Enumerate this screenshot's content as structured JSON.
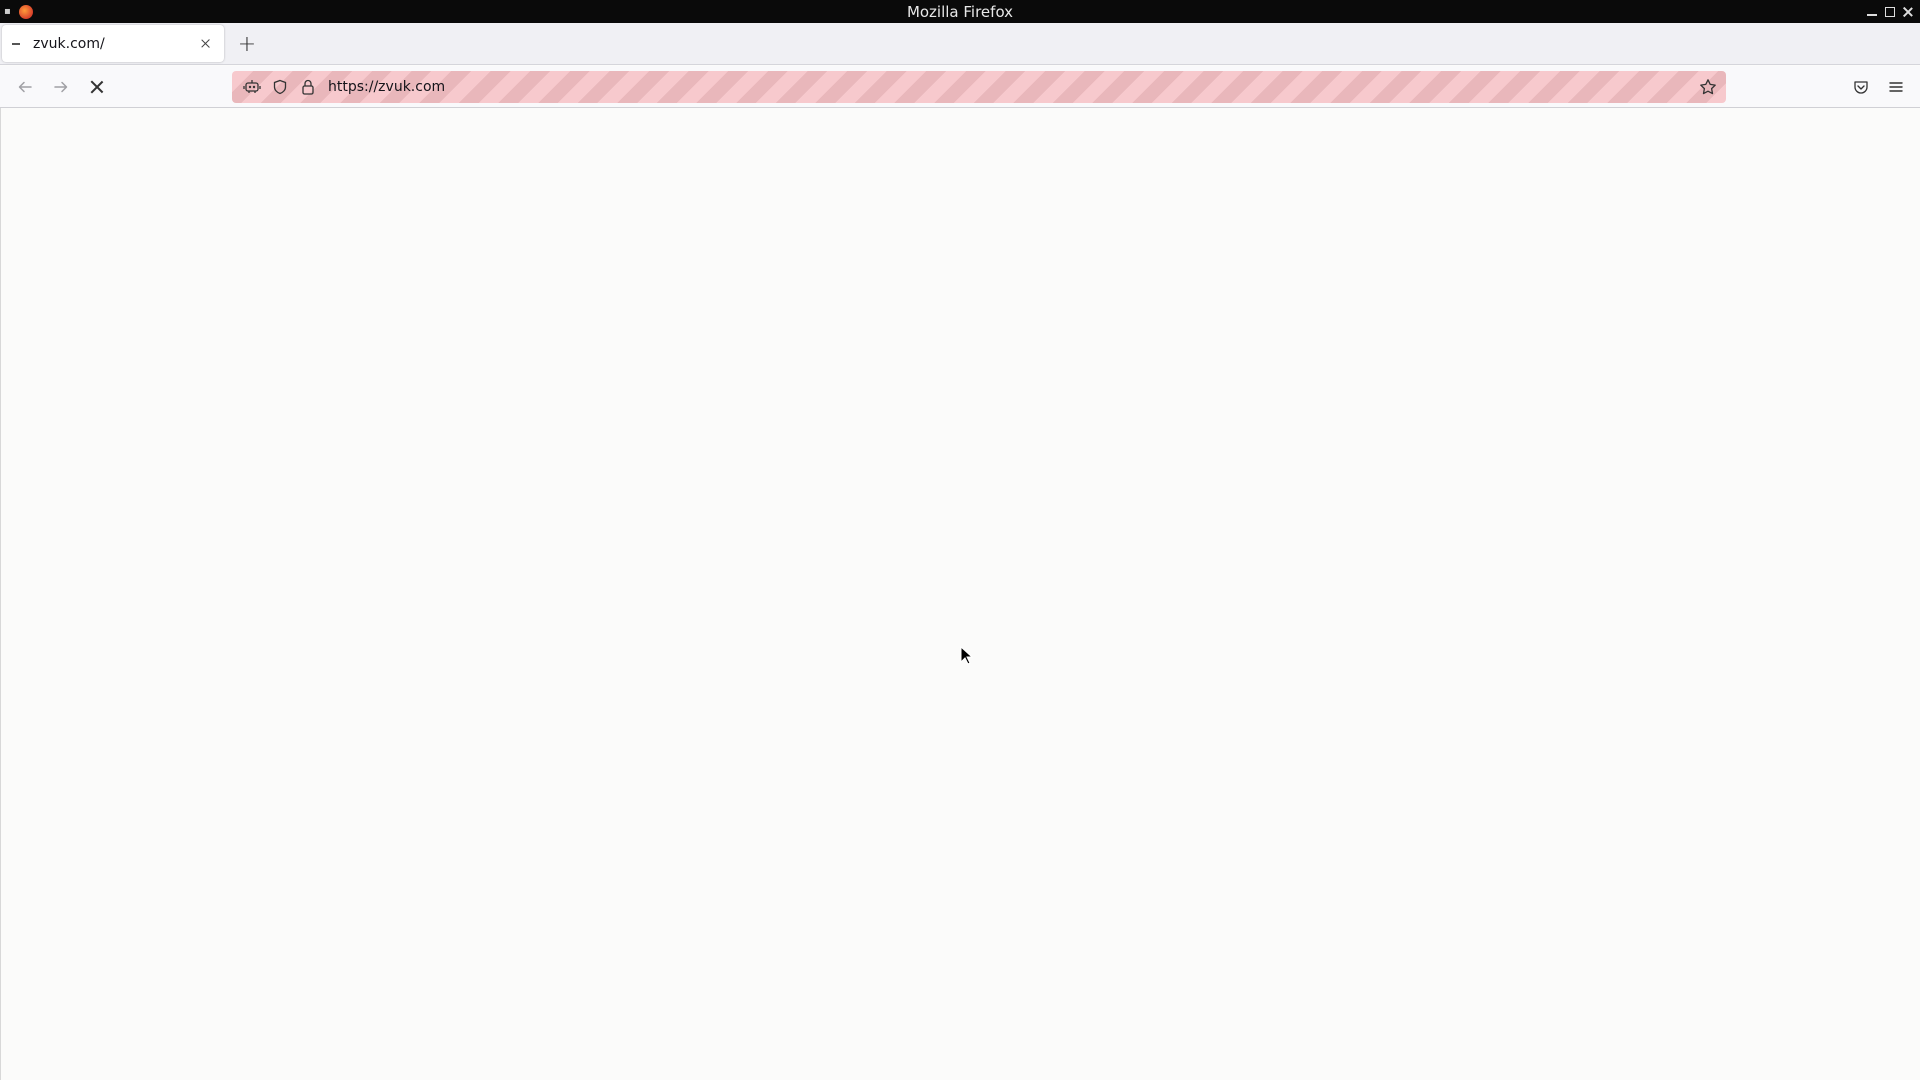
{
  "window": {
    "title": "Mozilla Firefox"
  },
  "tabs": [
    {
      "label": "zvuk.com/",
      "active": true
    }
  ],
  "toolbar": {
    "new_tab_label": "+",
    "url": "https://zvuk.com",
    "url_stripe_colors": [
      "#f7c9cd",
      "#e9b7bb"
    ],
    "icons": {
      "back": "arrow-left-icon",
      "forward": "arrow-right-icon",
      "stop": "close-icon",
      "remote_control": "robot-icon",
      "tracking_protection": "shield-icon",
      "site_security": "lock-icon",
      "bookmark": "star-icon",
      "pocket": "pocket-icon",
      "app_menu": "hamburger-menu-icon"
    }
  },
  "page": {
    "background": "#fbfbfa",
    "state": "loading"
  }
}
